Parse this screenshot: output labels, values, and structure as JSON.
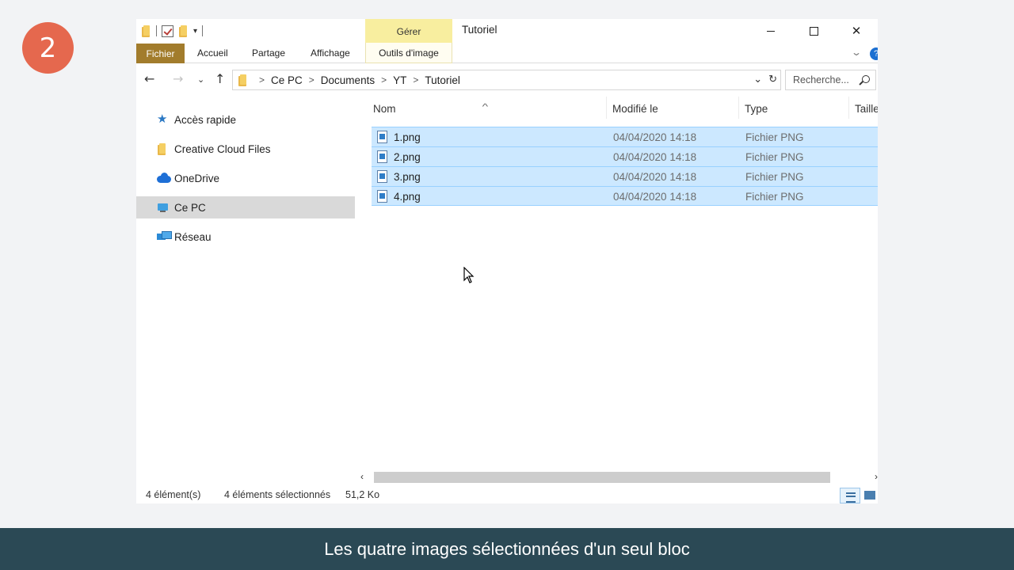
{
  "step": {
    "number": "2"
  },
  "window": {
    "title": "Tutoriel",
    "contextual_group": "Gérer",
    "controls": {
      "close": "✕"
    }
  },
  "ribbon": {
    "tabs": [
      "Fichier",
      "Accueil",
      "Partage",
      "Affichage",
      "Outils d'image"
    ],
    "help": "?"
  },
  "address": {
    "crumbs": [
      "Ce PC",
      "Documents",
      "YT",
      "Tutoriel"
    ],
    "search_placeholder": "Recherche..."
  },
  "sidebar": {
    "items": [
      {
        "label": "Accès rapide",
        "icon": "star-icon"
      },
      {
        "label": "Creative Cloud Files",
        "icon": "folder-icon"
      },
      {
        "label": "OneDrive",
        "icon": "cloud-icon"
      },
      {
        "label": "Ce PC",
        "icon": "computer-icon",
        "selected": true
      },
      {
        "label": "Réseau",
        "icon": "network-icon"
      }
    ]
  },
  "columns": [
    "Nom",
    "Modifié le",
    "Type",
    "Taille"
  ],
  "files": [
    {
      "name": "1.png",
      "modified": "04/04/2020 14:18",
      "type": "Fichier PNG",
      "selected": true
    },
    {
      "name": "2.png",
      "modified": "04/04/2020 14:18",
      "type": "Fichier PNG",
      "selected": true
    },
    {
      "name": "3.png",
      "modified": "04/04/2020 14:18",
      "type": "Fichier PNG",
      "selected": true
    },
    {
      "name": "4.png",
      "modified": "04/04/2020 14:18",
      "type": "Fichier PNG",
      "selected": true
    }
  ],
  "status": {
    "count": "4 élément(s)",
    "selection": "4 éléments sélectionnés",
    "size": "51,2 Ko"
  },
  "colors": {
    "badge": "#e5684e",
    "fichier_tab": "#a27c2c",
    "manage_tab": "#f8ee9f",
    "selection": "#cce8ff",
    "caption_bg": "#2b4955"
  },
  "caption": "Les quatre images sélectionnées d'un seul bloc"
}
